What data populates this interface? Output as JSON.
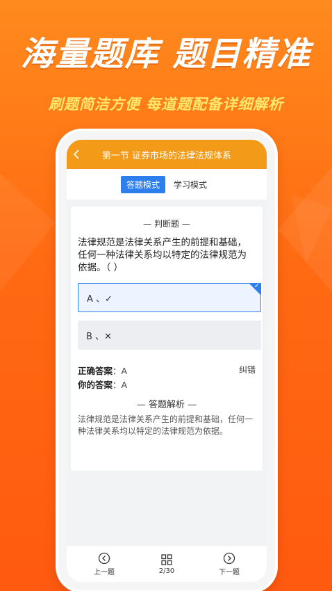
{
  "promo": {
    "headline": "海量题库  题目精准",
    "subline": "刷题简洁方便  每道题配备详细解析"
  },
  "colors": {
    "background": "#ff6a12",
    "topbar": "#f39a18",
    "accent": "#2d7ff0",
    "subline": "#ffe76a"
  },
  "header": {
    "back_icon": "chevron-left-icon",
    "title": "第一节 证券市场的法律法规体系"
  },
  "modes": {
    "answer_mode": "答题模式",
    "study_mode": "学习模式"
  },
  "question": {
    "type_label": "— 判断题 —",
    "text": "法律规范是法律关系产生的前提和基础，任何一种法律关系均以特定的法律规范为依据。（ ）",
    "options": [
      {
        "label": "A 、✓",
        "selected": true
      },
      {
        "label": "B 、✕",
        "selected": false
      }
    ]
  },
  "answers": {
    "correct_label": "正确答案",
    "correct_value": "：A",
    "yours_label": "你的答案",
    "yours_value": "：A",
    "report": "纠错"
  },
  "analysis": {
    "title": "— 答题解析 —",
    "text": "法律规范是法律关系产生的前提和基础，任何一种法律关系均以特定的法律规范为依据。"
  },
  "bottom_nav": {
    "prev": "上一题",
    "progress": "2/30",
    "next": "下一题"
  }
}
